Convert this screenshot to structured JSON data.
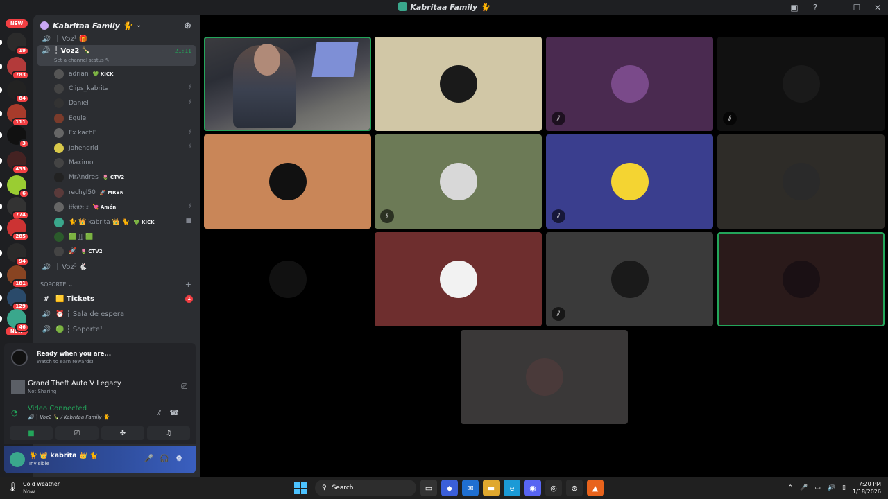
{
  "window": {
    "title": "Kabritaa Family 🐈",
    "controls": [
      "inbox-icon",
      "help-icon",
      "minimize-icon",
      "maximize-icon",
      "close-icon"
    ]
  },
  "rail": {
    "new_top": "NEW",
    "new_bottom": "NEW",
    "servers": [
      {
        "count": "19",
        "color": "#2b2b2b"
      },
      {
        "count": "783",
        "color": "#b33a3a"
      },
      {
        "count": "84",
        "color": "#222"
      },
      {
        "count": "111",
        "color": "#a83b2b"
      },
      {
        "count": "3",
        "color": "#111"
      },
      {
        "count": "435",
        "color": "#442222"
      },
      {
        "count": "6",
        "color": "#9acd32"
      },
      {
        "count": "774",
        "color": "#333"
      },
      {
        "count": "285",
        "color": "#cc3333"
      },
      {
        "count": "94",
        "color": "#2a2a2a"
      },
      {
        "count": "181",
        "color": "#884422"
      },
      {
        "count": "129",
        "color": "#2a4a6a"
      },
      {
        "count": "46",
        "color": "#3aa78c"
      }
    ]
  },
  "sidebar": {
    "guild_name": "Kabritaa Family 🐈",
    "channel_prev": "┆ Voz¹ 🎁",
    "active_channel": {
      "name": "┆ Voz2 🍾",
      "timer": "21:11",
      "status_placeholder": "Set a channel status ✎"
    },
    "members": [
      {
        "name": "adrian",
        "tag": "💚 KICK",
        "muted": false,
        "color": "#555"
      },
      {
        "name": "Clips_kabrita",
        "tag": "",
        "muted": true,
        "color": "#444"
      },
      {
        "name": "Daniel",
        "tag": "",
        "muted": true,
        "color": "#333"
      },
      {
        "name": "Equiel",
        "tag": "",
        "muted": false,
        "color": "#7a3b2b"
      },
      {
        "name": "Fx kachE",
        "tag": "",
        "muted": true,
        "color": "#666"
      },
      {
        "name": "Johendrid",
        "tag": "",
        "muted": true,
        "color": "#d9c94a"
      },
      {
        "name": "Maximo",
        "tag": "",
        "muted": false,
        "color": "#444"
      },
      {
        "name": "MrAndres",
        "tag": "🌷 CTV2",
        "muted": false,
        "color": "#222"
      },
      {
        "name": "rech𝓎l50",
        "tag": "🚀 MRBN",
        "muted": false,
        "color": "#5a3a3a"
      },
      {
        "name": "𝔱𝔦𝔣𝔢𝔫𝔬𝔱.𝔵",
        "tag": "💘 Amén",
        "muted": true,
        "color": "#666"
      },
      {
        "name": "🐈 👑 kabrita 👑 🐈",
        "tag": "💚 KICK",
        "muted": false,
        "color": "#3aa78c",
        "video": true
      },
      {
        "name": "🟩 𝕁𝕁 🟩",
        "tag": "",
        "muted": false,
        "color": "#2b5a2b"
      },
      {
        "name": "🚀",
        "tag": "🌷 CTV2",
        "muted": false,
        "color": "#444"
      }
    ],
    "channel_next": "┆ Voz³ 🐇",
    "category": "SOPORTE",
    "support_channels": [
      {
        "icon": "#",
        "name": "🟨 Tickets",
        "badge": "1",
        "bright": true
      },
      {
        "icon": "🔊",
        "name": "⏰ ┆ Sala de espera",
        "badge": "",
        "bright": false
      },
      {
        "icon": "🔊",
        "name": "🟢 ┆ Soporte¹",
        "badge": "",
        "bright": false
      }
    ]
  },
  "panels": {
    "reward_title": "Ready when you are...",
    "reward_sub": "Watch to earn rewards!",
    "game_title": "Grand Theft Auto V Legacy",
    "game_sub": "Not Sharing",
    "voice_title": "Video Connected",
    "voice_sub": "🔊 ┆ Voz2 🍾 / Kabritaa Family 🐈",
    "user_name": "🐈 👑 kabrita 👑 🐈",
    "user_status": "Invisible"
  },
  "tiles": [
    {
      "kind": "camera",
      "bg": "#3a3a3a",
      "speaking": true,
      "muted": false
    },
    {
      "kind": "avatar",
      "bg": "#d1c7a6",
      "avatar": "#1a1a1a",
      "muted": false
    },
    {
      "kind": "avatar",
      "bg": "#4a2a50",
      "avatar": "#7a4a8a",
      "muted": true
    },
    {
      "kind": "avatar",
      "bg": "#111111",
      "avatar": "#1a1a1a",
      "muted": true
    },
    {
      "kind": "avatar",
      "bg": "#c98658",
      "avatar": "#111111",
      "muted": false
    },
    {
      "kind": "avatar",
      "bg": "#6c7a56",
      "avatar": "#d8d8d8",
      "muted": true
    },
    {
      "kind": "avatar",
      "bg": "#3a3e8e",
      "avatar": "#f4d432",
      "muted": true
    },
    {
      "kind": "avatar",
      "bg": "#2e2c28",
      "avatar": "#2a2a2a",
      "muted": false
    },
    {
      "kind": "avatar",
      "bg": "#000000",
      "avatar": "#111111",
      "muted": false
    },
    {
      "kind": "avatar",
      "bg": "#6e2e2e",
      "avatar": "#f2f2f2",
      "muted": false
    },
    {
      "kind": "avatar",
      "bg": "#3a3a3a",
      "avatar": "#1a1a1a",
      "muted": true
    },
    {
      "kind": "avatar",
      "bg": "#2a1a1a",
      "avatar": "#1a1014",
      "speaking": true,
      "muted": false
    },
    {
      "kind": "avatar",
      "bg": "#3a3838",
      "avatar": "#4a3a3a",
      "muted": false
    }
  ],
  "taskbar": {
    "weather_title": "Cold weather",
    "weather_sub": "Now",
    "search_placeholder": "Search",
    "time": "7:20 PM",
    "date": "1/18/2026"
  }
}
